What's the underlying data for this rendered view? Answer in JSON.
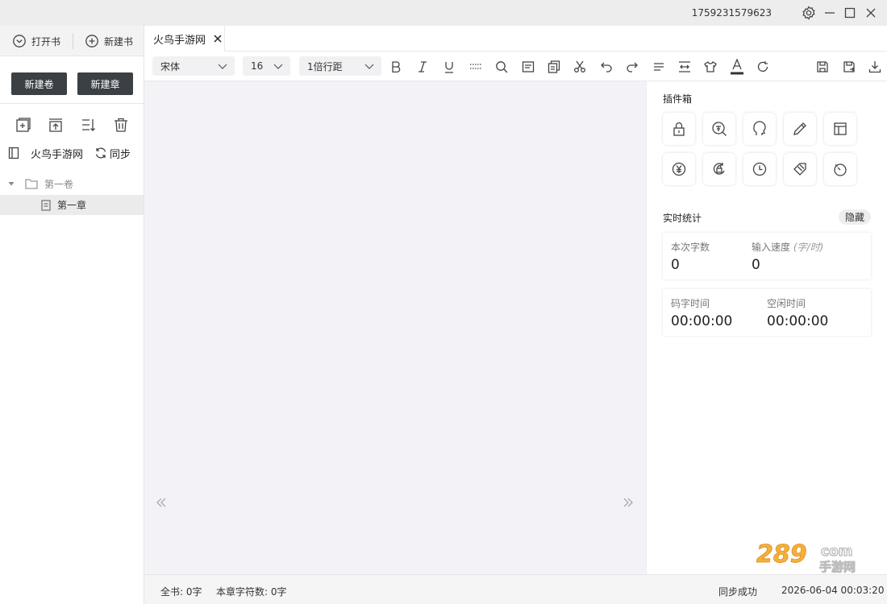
{
  "titlebar": {
    "user_id": "1759231579623"
  },
  "sidebar": {
    "open_book": "打开书",
    "new_book": "新建书",
    "new_volume": "新建卷",
    "new_chapter": "新建章",
    "book_name": "火鸟手游网",
    "sync": "同步",
    "tree": {
      "volume": "第一卷",
      "chapter": "第一章"
    }
  },
  "tab": {
    "label": "火鸟手游网"
  },
  "toolbar": {
    "font": "宋体",
    "size": "16",
    "line_spacing": "1倍行距"
  },
  "plugins": {
    "title": "插件箱",
    "icons": [
      "lock-icon",
      "dictionary-icon",
      "head-icon",
      "pencil-icon",
      "layout-icon",
      "yen-icon",
      "lock-rotate-icon",
      "clock-icon",
      "tag-icon",
      "timer-icon"
    ]
  },
  "stats": {
    "title": "实时统计",
    "hide": "隐藏",
    "session_words_label": "本次字数",
    "session_words": "0",
    "speed_label": "输入速度",
    "speed_unit": "(字/时)",
    "speed": "0",
    "typing_time_label": "码字时间",
    "typing_time": "00:00:00",
    "idle_time_label": "空闲时间",
    "idle_time": "00:00:00"
  },
  "status": {
    "book_total": "全书: 0字",
    "chapter_chars": "本章字符数: 0字",
    "sync_status": "同步成功",
    "datetime": "2026-06-04 00:03:20"
  },
  "watermark": {
    "brand": "289",
    "suffix": "com",
    "sub": "手游网"
  }
}
